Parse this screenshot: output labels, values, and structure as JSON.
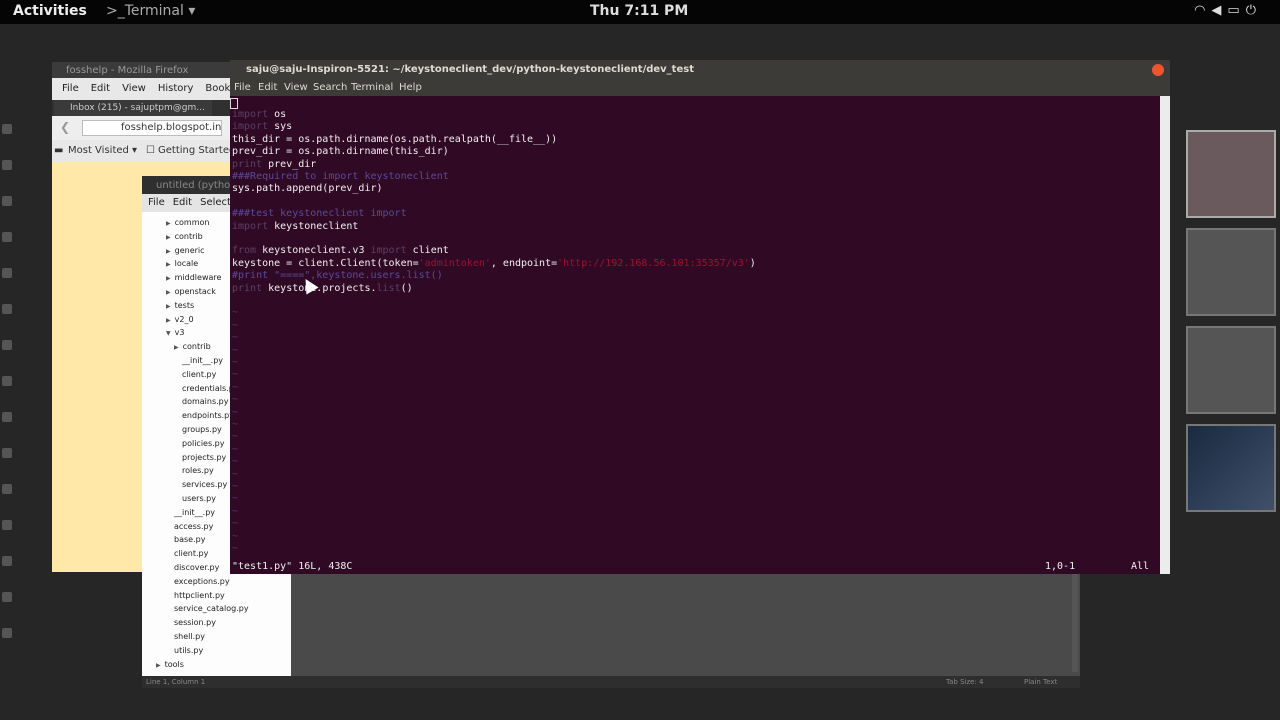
{
  "topbar": {
    "activities": "Activities",
    "app_menu": ">_Terminal ▾",
    "clock": "Thu  7:11 PM",
    "tray_icons": [
      "wifi-icon",
      "volume-icon",
      "battery-icon",
      "power-icon"
    ]
  },
  "firefox": {
    "title": "fosshelp - Mozilla Firefox",
    "menu": [
      "File",
      "Edit",
      "View",
      "History",
      "Bookmarks"
    ],
    "tab_label": "Inbox (215) - sajuptpm@gm...",
    "url": "fosshelp.blogspot.in",
    "bookmarks": [
      "Most Visited ▾",
      "Getting Started"
    ]
  },
  "gedit": {
    "title": "untitled (pytho",
    "menu": [
      "File",
      "Edit",
      "Selecti"
    ],
    "tree": [
      {
        "label": "common",
        "arrow": "▶"
      },
      {
        "label": "contrib",
        "arrow": "▶"
      },
      {
        "label": "generic",
        "arrow": "▶"
      },
      {
        "label": "locale",
        "arrow": "▶"
      },
      {
        "label": "middleware",
        "arrow": "▶"
      },
      {
        "label": "openstack",
        "arrow": "▶"
      },
      {
        "label": "tests",
        "arrow": "▶"
      },
      {
        "label": "v2_0",
        "arrow": "▶"
      },
      {
        "label": "v3",
        "arrow": "▼"
      },
      {
        "label": "contrib",
        "arrow": "▶"
      },
      {
        "label": "__init__.py",
        "arrow": ""
      },
      {
        "label": "client.py",
        "arrow": ""
      },
      {
        "label": "credentials.p",
        "arrow": ""
      },
      {
        "label": "domains.py",
        "arrow": ""
      },
      {
        "label": "endpoints.py",
        "arrow": ""
      },
      {
        "label": "groups.py",
        "arrow": ""
      },
      {
        "label": "policies.py",
        "arrow": ""
      },
      {
        "label": "projects.py",
        "arrow": ""
      },
      {
        "label": "roles.py",
        "arrow": ""
      },
      {
        "label": "services.py",
        "arrow": ""
      },
      {
        "label": "users.py",
        "arrow": ""
      },
      {
        "label": "__init__.py",
        "arrow": ""
      },
      {
        "label": "access.py",
        "arrow": ""
      },
      {
        "label": "base.py",
        "arrow": ""
      },
      {
        "label": "client.py",
        "arrow": ""
      },
      {
        "label": "discover.py",
        "arrow": ""
      },
      {
        "label": "exceptions.py",
        "arrow": ""
      },
      {
        "label": "httpclient.py",
        "arrow": ""
      },
      {
        "label": "service_catalog.py",
        "arrow": ""
      },
      {
        "label": "session.py",
        "arrow": ""
      },
      {
        "label": "shell.py",
        "arrow": ""
      },
      {
        "label": "utils.py",
        "arrow": ""
      },
      {
        "label": "tools",
        "arrow": "▶"
      }
    ],
    "status_left": "Line 1, Column 1",
    "status_tab": "Tab Size: 4",
    "status_lang": "Plain Text"
  },
  "terminal": {
    "title": "saju@saju-Inspiron-5521: ~/keystoneclient_dev/python-keystoneclient/dev_test",
    "menu": [
      "File",
      "Edit",
      "View",
      "Search",
      "Terminal",
      "Help"
    ],
    "code": [
      {
        "kw": "import",
        "rest": " os"
      },
      {
        "kw": "import",
        "rest": " sys"
      },
      {
        "kw": "",
        "rest": "this_dir = os.path.dirname(os.path.realpath(__file__))"
      },
      {
        "kw": "",
        "rest": "prev_dir = os.path.dirname(this_dir)"
      },
      {
        "kw": "print",
        "rest": " prev_dir"
      },
      {
        "kw": "",
        "rest": "",
        "comment": "###Required to import keystoneclient"
      },
      {
        "kw": "",
        "rest": "sys.path.append(prev_dir)"
      },
      {
        "kw": "",
        "rest": ""
      },
      {
        "kw": "",
        "rest": "",
        "comment": "###test keystoneclient import"
      },
      {
        "kw": "import",
        "rest": " keystoneclient"
      },
      {
        "kw": "",
        "rest": ""
      },
      {
        "kw": "from",
        "rest": " keystoneclient.v3 ",
        "kw2": "import",
        "rest2": " client"
      },
      {
        "kw": "",
        "rest": "keystone = client.Client(token=",
        "str": "'admintoken'",
        "rest2": ", endpoint=",
        "str2": "'http://192.168.56.101:35357/v3'",
        "rest3": ")"
      },
      {
        "kw": "",
        "rest": "",
        "comment": "#print \"====\",keystone.users.list()"
      },
      {
        "kw": "print",
        "rest": " keystone.projects.",
        "kw2": "list",
        "rest2": "()"
      }
    ],
    "tilde": "~",
    "status_file": "\"test1.py\" 16L, 438C",
    "status_pos": "1,0-1",
    "status_all": "All"
  }
}
